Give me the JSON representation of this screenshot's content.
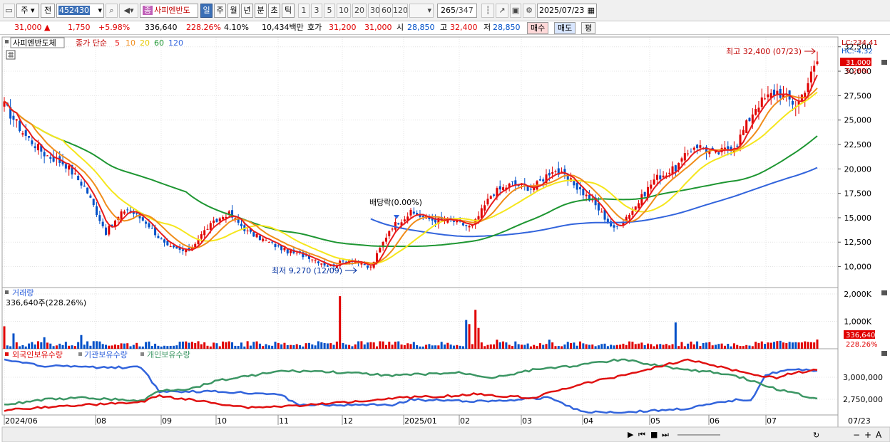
{
  "toolbar": {
    "market": "주",
    "prev": "전",
    "code": "452430",
    "stock_name_tag": "종",
    "stock_name": "사피엔반도",
    "periods": [
      "일",
      "주",
      "월",
      "년",
      "분",
      "초",
      "틱"
    ],
    "intervals": [
      "1",
      "3",
      "5",
      "10",
      "20",
      "30",
      "60",
      "120"
    ],
    "count": "265",
    "total": "/347",
    "date": "2025/07/23"
  },
  "quote": {
    "price": "31,000 ▲",
    "change": "1,750",
    "change_pct": "+5.98%",
    "volume": "336,640",
    "volume_pct": "228.26%",
    "turnover_pct": "4.10%",
    "amount": "10,434백만",
    "hoga_label": "호가",
    "ask": "31,200",
    "bid": "31,000",
    "open_label": "시",
    "open": "28,850",
    "high_label": "고",
    "high": "32,400",
    "low_label": "저",
    "low": "28,850",
    "buy_label": "매수",
    "sell_label": "매도",
    "eval_label": "평"
  },
  "colors": {
    "up": "#e00000",
    "down": "#0050c8",
    "ma5": "#e81c1c",
    "ma10": "#f08c1a",
    "ma20": "#f5e61c",
    "ma60": "#1e9632",
    "ma120": "#3264dc",
    "foreign": "#e01010",
    "institution": "#3264dc",
    "individual": "#3c9664"
  },
  "chart_data": [
    {
      "type": "candlestick",
      "title": "사피엔반도체",
      "legend": [
        "종가 단순",
        "5",
        "10",
        "20",
        "60",
        "120"
      ],
      "y_ticks": [
        "32,500",
        "30,000",
        "27,500",
        "25,000",
        "22,500",
        "20,000",
        "17,500",
        "15,000",
        "12,500",
        "10,000"
      ],
      "x_ticks": [
        "2024/06",
        "08",
        "09",
        "10",
        "11",
        "12",
        "2025/01",
        "02",
        "03",
        "04",
        "05",
        "06",
        "07",
        "07/23"
      ],
      "ylim": [
        8000,
        33500
      ],
      "annotations": {
        "high": "최고 32,400 (07/23)",
        "low": "최저 9,270 (12/09)",
        "dividend": "배당락(0.00%)",
        "lc": "LC:234.41",
        "hc": "HC:-4.32",
        "last": "31,000",
        "last_pct": "5.26%"
      },
      "close_points": [
        [
          "2024/06",
          26500
        ],
        [
          "06 mid",
          23500
        ],
        [
          "07 early",
          21500
        ],
        [
          "07 mid",
          20500
        ],
        [
          "07 late",
          18000
        ],
        [
          "08 early",
          13500
        ],
        [
          "08 mid",
          16000
        ],
        [
          "08 late",
          14500
        ],
        [
          "09 early",
          12000
        ],
        [
          "09 mid",
          11500
        ],
        [
          "09 late",
          14000
        ],
        [
          "10 early",
          15500
        ],
        [
          "10 mid",
          13500
        ],
        [
          "10 late",
          12500
        ],
        [
          "11 early",
          11500
        ],
        [
          "11 mid",
          11000
        ],
        [
          "11 late",
          10000
        ],
        [
          "12 early",
          10800
        ],
        [
          "12/09",
          9800
        ],
        [
          "12 late",
          14000
        ],
        [
          "2025/01 early",
          15500
        ],
        [
          "01 mid",
          14800
        ],
        [
          "01 late",
          14700
        ],
        [
          "02 early",
          14000
        ],
        [
          "02 mid",
          17500
        ],
        [
          "02 late",
          18500
        ],
        [
          "03 early",
          18000
        ],
        [
          "03 mid",
          20000
        ],
        [
          "03 late",
          18500
        ],
        [
          "04 early",
          16500
        ],
        [
          "04 mid",
          13800
        ],
        [
          "04 late",
          16000
        ],
        [
          "05 early",
          19000
        ],
        [
          "05 mid",
          20000
        ],
        [
          "05 late",
          22500
        ],
        [
          "06 early",
          21500
        ],
        [
          "06 mid",
          22500
        ],
        [
          "06 late",
          26500
        ],
        [
          "07 early",
          28000
        ],
        [
          "07 mid",
          26500
        ],
        [
          "07/23",
          31000
        ]
      ]
    },
    {
      "type": "bar",
      "title": "거래량",
      "label": "336,640주(228.26%)",
      "y_ticks": [
        "2,000K",
        "1,000K"
      ],
      "ylim": [
        0,
        2000
      ],
      "last": "336,640",
      "last_pct": "228.26%"
    },
    {
      "type": "line",
      "series": [
        {
          "name": "외국인보유수량"
        },
        {
          "name": "기관보유수량"
        },
        {
          "name": "개인보유수량"
        }
      ],
      "y_ticks": [
        "3,000,000",
        "2,750,000"
      ]
    }
  ]
}
